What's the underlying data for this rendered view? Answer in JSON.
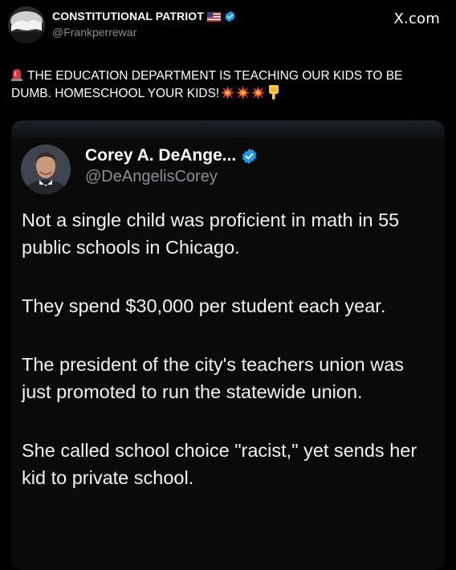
{
  "post": {
    "author_name": "CONSTITUTIONAL PATRIOT",
    "author_handle": "@Frankperrewar",
    "site_brand": "X.com",
    "text": "THE EDUCATION DEPARTMENT IS TEACHING OUR KIDS TO BE DUMB. HOMESCHOOL YOUR KIDS!",
    "icons": {
      "flag": "us-flag-icon",
      "verified": "verified-badge-icon",
      "leading": "siren-icon",
      "trailing": [
        "collision-icon",
        "collision-icon",
        "collision-icon",
        "pointing-down-icon"
      ]
    }
  },
  "quote": {
    "author_name": "Corey A. DeAnge...",
    "author_handle": "@DeAngelisCorey",
    "paragraphs": [
      "Not a single child was proficient in math in 55 public schools in Chicago.",
      "They spend $30,000 per student each year.",
      "The president of the city's teachers union was just promoted to run the statewide union.",
      "She called school choice \"racist,\" yet sends her kid to private school."
    ]
  },
  "colors": {
    "background": "#000000",
    "text_primary": "#ffffff",
    "text_secondary": "#8b8f94",
    "verified_blue": "#1d9bf0"
  }
}
